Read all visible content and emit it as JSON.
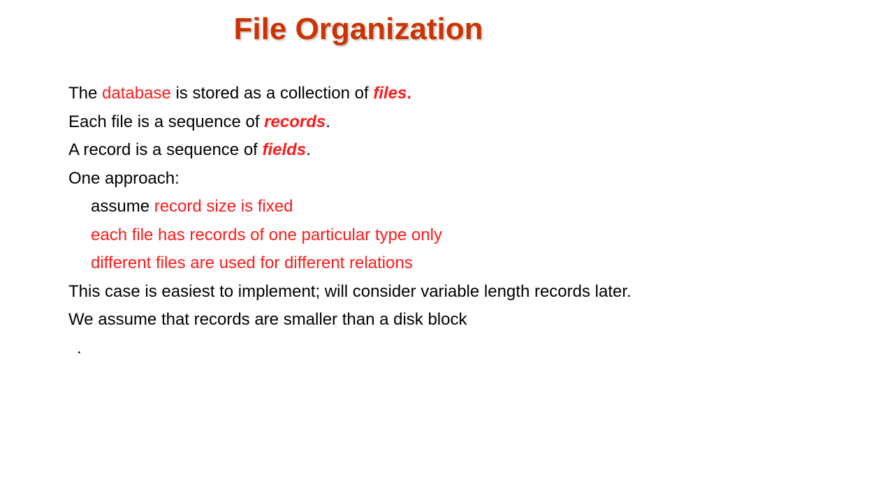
{
  "slide": {
    "title": "File Organization",
    "colors": {
      "title": "#cc3300",
      "highlight": "#ff1a1a",
      "text": "#000000"
    },
    "lines": {
      "l1": {
        "a": "The ",
        "b": "database",
        "c": " is stored as a collection of ",
        "d": "files",
        "e": "."
      },
      "l2": {
        "a": "Each file is a sequence of ",
        "b": "records",
        "c": "."
      },
      "l3": {
        "a": "A record is a sequence of ",
        "b": "fields",
        "c": "."
      },
      "l4": "One approach:",
      "l5": {
        "a": "assume ",
        "b": "record size is fixed"
      },
      "l6": "each file has records of one particular type only",
      "l7": "different files are used for different relations",
      "l8": "This case is easiest to implement; will consider variable length records later.",
      "l9": "We assume that records are smaller than a disk block",
      "l10": "."
    }
  }
}
